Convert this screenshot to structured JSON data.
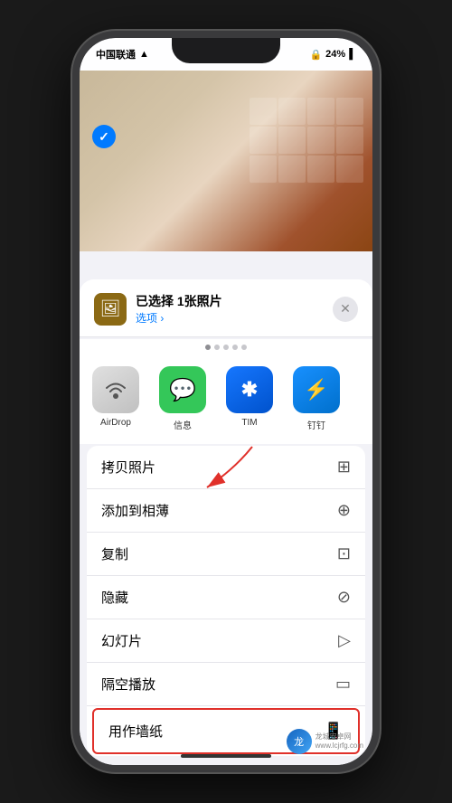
{
  "status": {
    "carrier": "中国联通",
    "signal": "▲",
    "wifi": "wifi",
    "battery_percent": "24%",
    "battery_icon": "🔋",
    "lock_icon": "🔒"
  },
  "share_header": {
    "icon": "🖼",
    "title": "已选择 1张照片",
    "subtitle": "选项 ›",
    "close_label": "✕"
  },
  "dots": [
    "",
    "",
    "",
    "",
    ""
  ],
  "app_icons": [
    {
      "id": "airdrop",
      "label": "AirDrop",
      "emoji": "📶"
    },
    {
      "id": "messages",
      "label": "信息",
      "emoji": "💬"
    },
    {
      "id": "tim",
      "label": "TIM",
      "emoji": "✱"
    },
    {
      "id": "dingding",
      "label": "钉钉",
      "emoji": "⚡"
    }
  ],
  "menu_items": [
    {
      "id": "copy-photo",
      "label": "拷贝照片",
      "icon": "⊞",
      "highlighted": false
    },
    {
      "id": "add-to-album",
      "label": "添加到相薄",
      "icon": "⊕",
      "highlighted": false
    },
    {
      "id": "duplicate",
      "label": "复制",
      "icon": "⊡",
      "highlighted": false
    },
    {
      "id": "hide",
      "label": "隐藏",
      "icon": "⊘",
      "highlighted": false
    },
    {
      "id": "slideshow",
      "label": "幻灯片",
      "icon": "▷",
      "highlighted": false
    },
    {
      "id": "airplay",
      "label": "隔空播放",
      "icon": "▭",
      "highlighted": false
    },
    {
      "id": "wallpaper",
      "label": "用作墙纸",
      "icon": "📱",
      "highlighted": true
    }
  ],
  "watermark": {
    "site1": "龙城安卓网",
    "site2": "www.lcjrfg.com"
  }
}
